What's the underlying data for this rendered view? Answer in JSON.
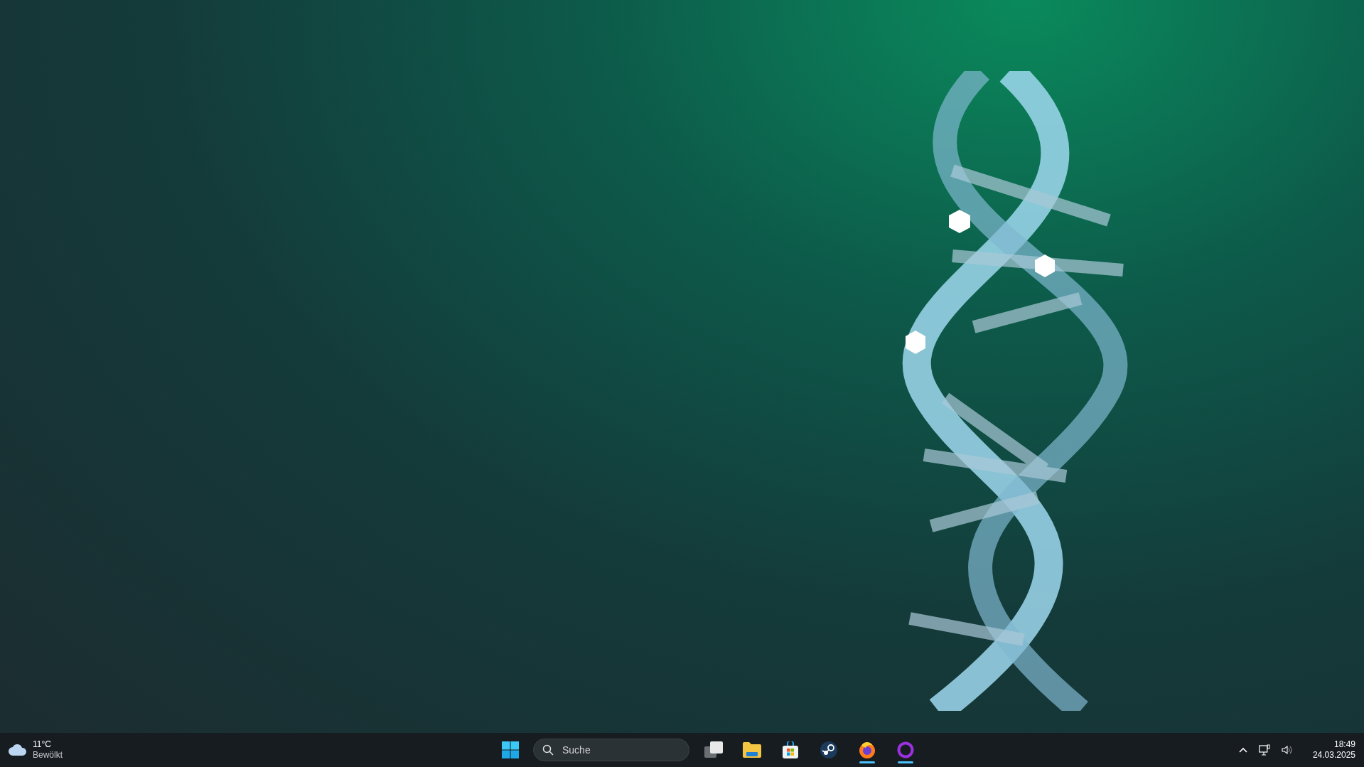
{
  "weather": {
    "temperature": "11°C",
    "condition": "Bewölkt"
  },
  "search": {
    "placeholder": "Suche"
  },
  "taskbar_apps": [
    {
      "kind": "taskview",
      "running": false
    },
    {
      "kind": "folder",
      "running": false
    },
    {
      "kind": "store",
      "running": false
    },
    {
      "kind": "steam",
      "running": false
    },
    {
      "kind": "firefox",
      "running": true
    },
    {
      "kind": "ring",
      "running": true
    }
  ],
  "clock": {
    "time": "18:49",
    "date": "24.03.2025"
  }
}
